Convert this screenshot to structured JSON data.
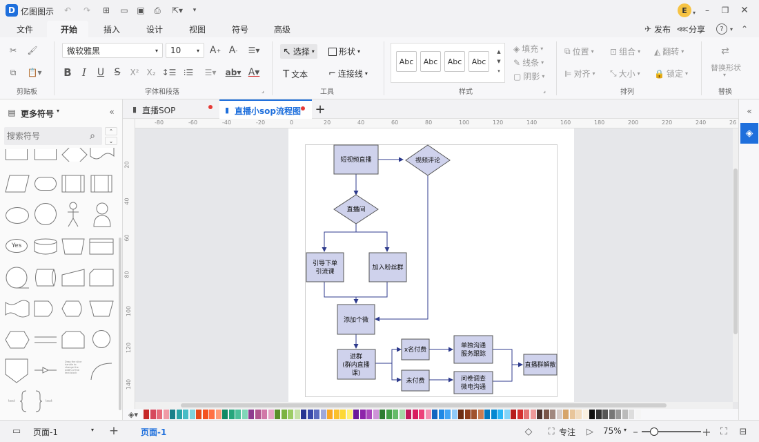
{
  "app": {
    "title": "亿图图示",
    "brand_color": "#1e6fdc",
    "avatar_letter": "E"
  },
  "menu": {
    "items": [
      "文件",
      "开始",
      "插入",
      "设计",
      "视图",
      "符号",
      "高级"
    ],
    "active": "开始",
    "publish": "发布",
    "share": "分享",
    "help": "?"
  },
  "ribbon": {
    "font_family": "微软雅黑",
    "font_size": "10",
    "select_label": "选择",
    "shape_label": "形状",
    "text_label": "文本",
    "connector_label": "连接线",
    "style_samples": [
      "Abc",
      "Abc",
      "Abc",
      "Abc"
    ],
    "fill": "填充",
    "line": "线条",
    "shadow": "阴影",
    "position": "位置",
    "group": "组合",
    "flip": "翻转",
    "align": "对齐",
    "size": "大小",
    "lock": "锁定",
    "replace_shape": "替换形状",
    "groups": [
      "剪贴板",
      "字体和段落",
      "工具",
      "样式",
      "排列",
      "替换"
    ]
  },
  "left_panel": {
    "title": "更多符号",
    "search_placeholder": "搜索符号",
    "yes_label": "Yes",
    "text_sample": "Drag the slice handle to change the width of the text block",
    "brace_left": "text",
    "brace_right": "text"
  },
  "doc_tabs": [
    {
      "label": "直播SOP",
      "active": false
    },
    {
      "label": "直播小sop流程图",
      "active": true
    }
  ],
  "rulers": {
    "h": [
      "-80",
      "-60",
      "-40",
      "-20",
      "0",
      "20",
      "40",
      "60",
      "80",
      "100",
      "120",
      "140",
      "160",
      "180",
      "200",
      "220",
      "240",
      "26"
    ],
    "v": [
      "20",
      "40",
      "60",
      "80",
      "100",
      "120",
      "140"
    ]
  },
  "flowchart": {
    "nodes": [
      {
        "id": "n1",
        "text": [
          "短视频直播"
        ]
      },
      {
        "id": "n2",
        "text": [
          "视频评论"
        ]
      },
      {
        "id": "n3",
        "text": [
          "直播间"
        ]
      },
      {
        "id": "n4",
        "text": [
          "引导下单",
          "引流课"
        ]
      },
      {
        "id": "n5",
        "text": [
          "加入粉丝群"
        ]
      },
      {
        "id": "n6",
        "text": [
          "添加个微"
        ]
      },
      {
        "id": "n7",
        "text": [
          "进群",
          "(群内直播",
          "课)"
        ]
      },
      {
        "id": "n8",
        "text": [
          "x名付费"
        ]
      },
      {
        "id": "n9",
        "text": [
          "未付费"
        ]
      },
      {
        "id": "n10",
        "text": [
          "单独沟通",
          "服务跟踪"
        ]
      },
      {
        "id": "n11",
        "text": [
          "问卷调查",
          "微电沟通"
        ]
      },
      {
        "id": "n12",
        "text": [
          "直播群解散"
        ]
      }
    ],
    "node_fill": "#cfd2ec",
    "edge_color": "#2d3a8c"
  },
  "palette": [
    "#c62828",
    "#d6495d",
    "#e66b7b",
    "#f09aa5",
    "#1a7f8a",
    "#2aa3a8",
    "#47bcc6",
    "#7fd3db",
    "#e64a19",
    "#f4511e",
    "#ff7043",
    "#ff9a76",
    "#118a65",
    "#26a67c",
    "#4cc09a",
    "#80d6b8",
    "#8e3b8f",
    "#b0558f",
    "#d179a8",
    "#e6a5c6",
    "#5a8f29",
    "#7cb342",
    "#9ccc65",
    "#c5e1a5",
    "#283593",
    "#3949ab",
    "#5c6bc0",
    "#9fa8da",
    "#f9a825",
    "#fbc02d",
    "#fdd835",
    "#fff176",
    "#6a1b9a",
    "#8e24aa",
    "#ab47bc",
    "#ce93d8",
    "#2e7d32",
    "#43a047",
    "#66bb6a",
    "#a5d6a7",
    "#c2185b",
    "#d81b60",
    "#ec407a",
    "#f48fb1",
    "#1565c0",
    "#1e88e5",
    "#42a5f5",
    "#90caf9",
    "#6d2c12",
    "#8d3b1a",
    "#a0522d",
    "#c97c52",
    "#0277bd",
    "#0288d1",
    "#29b6f6",
    "#81d4fa",
    "#b71c1c",
    "#d32f2f",
    "#e57373",
    "#ef9a9a",
    "#4e342e",
    "#795548",
    "#a1887f",
    "#d7ccc8",
    "#d6a46a",
    "#e8c59a",
    "#f1dcc0",
    "#faf0e0",
    "#111111",
    "#333333",
    "#555555",
    "#777777",
    "#999999",
    "#bbbbbb",
    "#dddddd",
    "#f5f5f5"
  ],
  "status": {
    "page_select": "页面-1",
    "page_tab": "页面-1",
    "focus": "专注",
    "zoom": "75%"
  }
}
